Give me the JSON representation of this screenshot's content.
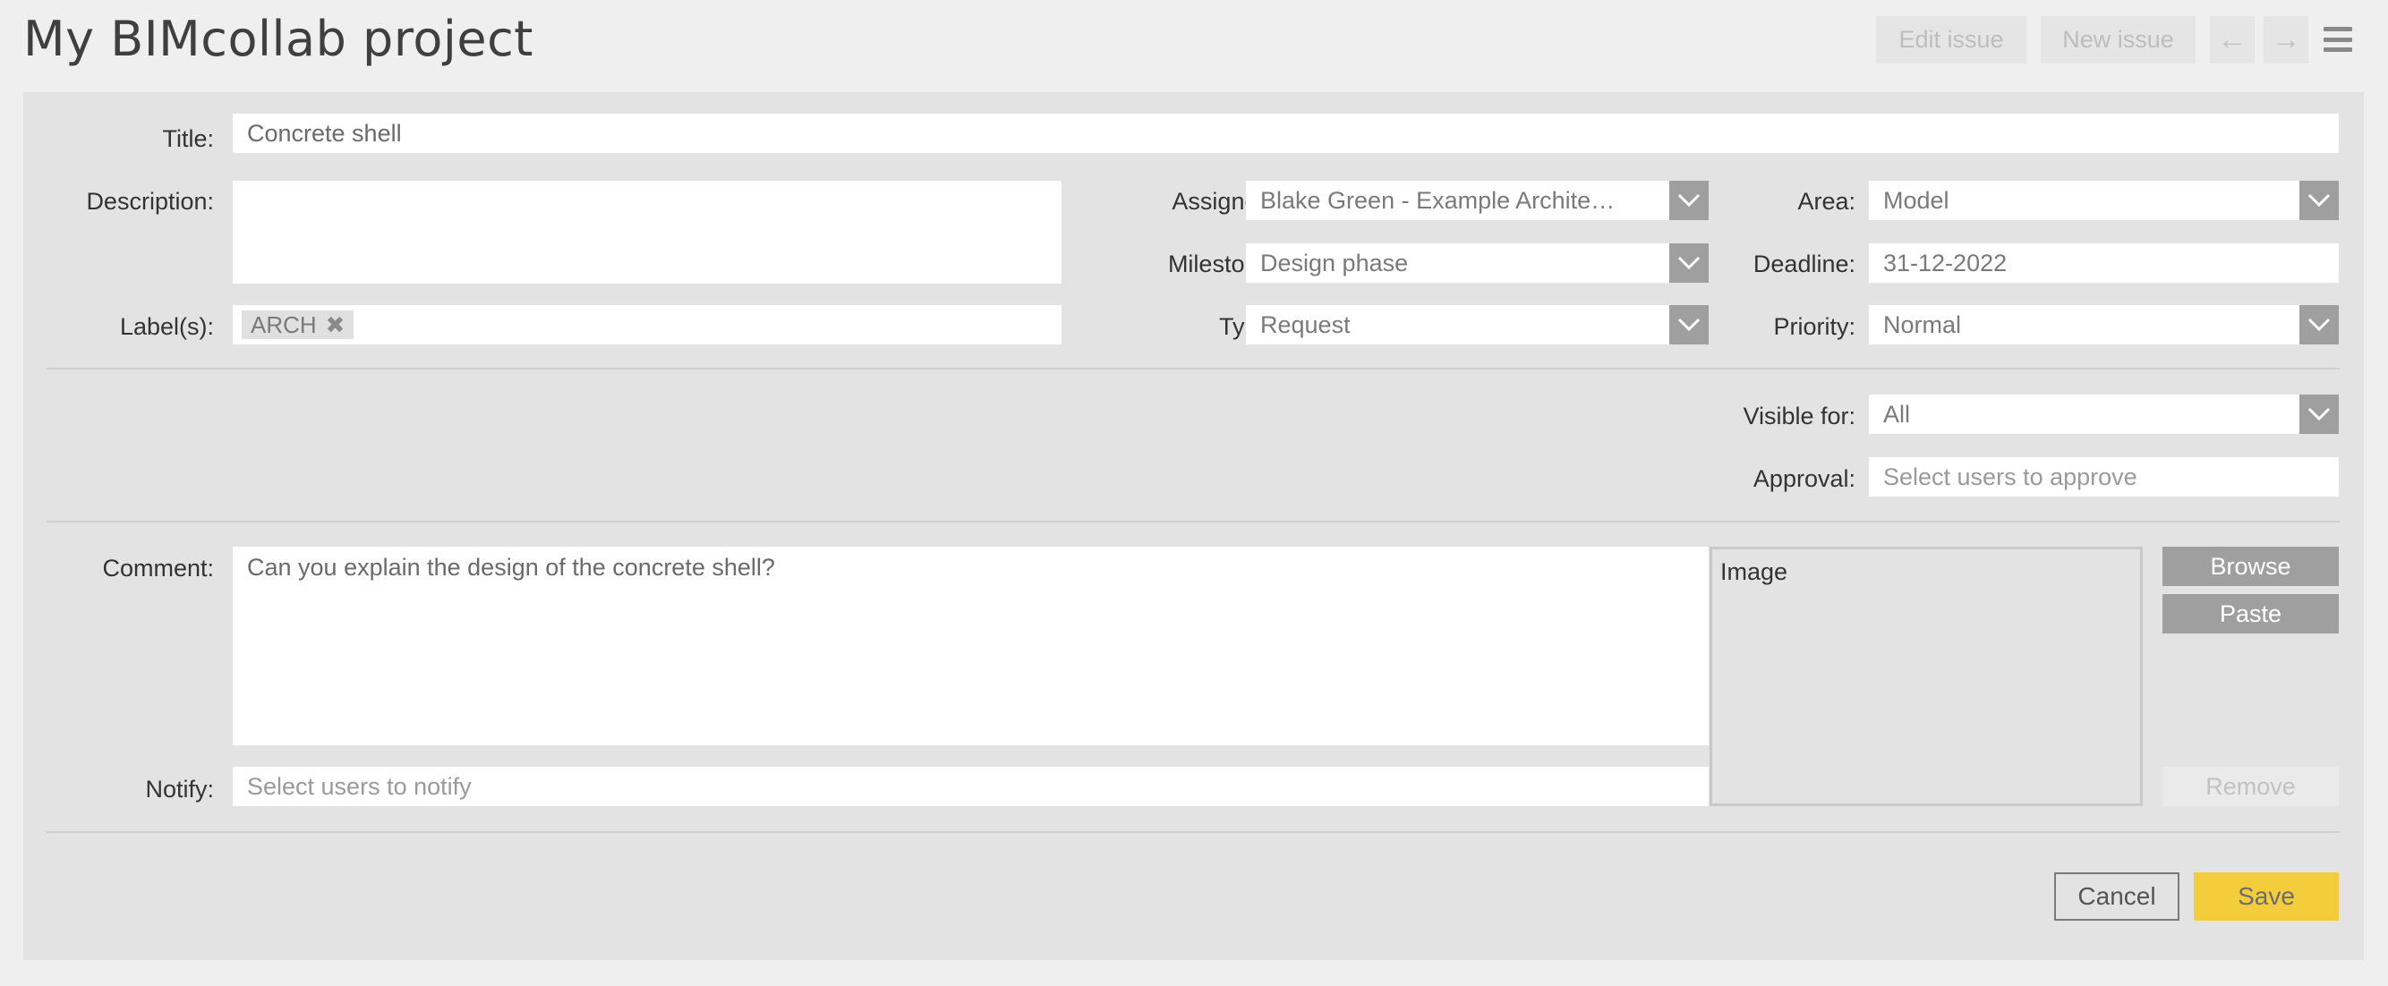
{
  "header": {
    "title": "My BIMcollab project",
    "edit_issue": "Edit issue",
    "new_issue": "New issue",
    "prev_arrow": "←",
    "next_arrow": "→"
  },
  "form": {
    "title": {
      "label": "Title:",
      "value": "Concrete shell"
    },
    "description": {
      "label": "Description:",
      "value": ""
    },
    "labels": {
      "label": "Label(s):",
      "tags": [
        "ARCH"
      ],
      "remove_glyph": "✖"
    },
    "assigned": {
      "label": "Assigned:",
      "value": "Blake Green - Example Archite…"
    },
    "milestone": {
      "label": "Milestone:",
      "value": "Design phase"
    },
    "type": {
      "label": "Type:",
      "value": "Request"
    },
    "area": {
      "label": "Area:",
      "value": "Model"
    },
    "deadline": {
      "label": "Deadline:",
      "value": "31-12-2022"
    },
    "priority": {
      "label": "Priority:",
      "value": "Normal"
    },
    "visible_for": {
      "label": "Visible for:",
      "value": "All"
    },
    "approval": {
      "label": "Approval:",
      "placeholder": "Select users to approve"
    },
    "comment": {
      "label": "Comment:",
      "value": "Can you explain the design of the concrete shell?"
    },
    "notify": {
      "label": "Notify:",
      "placeholder": "Select users to notify"
    },
    "image": {
      "label": "Image"
    },
    "buttons": {
      "browse": "Browse",
      "paste": "Paste",
      "remove": "Remove",
      "cancel": "Cancel",
      "save": "Save"
    }
  },
  "icons": {
    "dropdown": "chevron-down-icon",
    "menu": "hamburger-menu-icon",
    "tag_remove": "close-icon"
  },
  "colors": {
    "background": "#efefef",
    "panel": "#e4e3e3",
    "select_arrow": "#9f9f9f",
    "save_accent": "#f4cd3c"
  }
}
